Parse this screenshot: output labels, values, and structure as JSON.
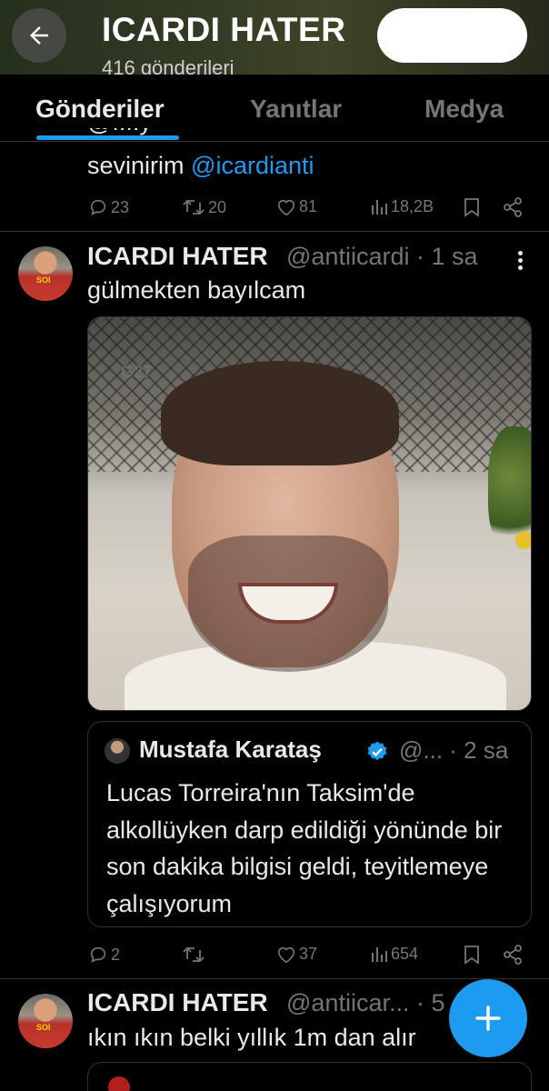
{
  "header": {
    "title": "ICARDI HATER",
    "subtitle": "416 gönderileri",
    "back_icon": "arrow-left-icon"
  },
  "tabs": [
    {
      "label": "Gönderiler",
      "active": true
    },
    {
      "label": "Yanıtlar",
      "active": false
    },
    {
      "label": "Medya",
      "active": false
    }
  ],
  "tweets": [
    {
      "text_partial_top": "@ı.ı.y",
      "text": "sevinirim",
      "mention": "@icardianti",
      "replies": "23",
      "retweets": "20",
      "likes": "81",
      "views": "18,2B"
    },
    {
      "name": "ICARDI HATER",
      "handle": "@antiicardi · 1 sa",
      "text": "gülmekten bayılcam",
      "media_watermark": "G27",
      "quote": {
        "name": "Mustafa Karataş",
        "handle": "@... · 2 sa",
        "text": "Lucas Torreira'nın Taksim'de alkollüyken darp edildiği yönünde bir son dakika bilgisi geldi, teyitlemeye çalışıyorum"
      },
      "replies": "2",
      "retweets": "",
      "likes": "37",
      "views": "654"
    },
    {
      "name": "ICARDI HATER",
      "handle": "@antiicar... · 5",
      "text": "ıkın ıkın belki yıllık 1m dan alır"
    }
  ],
  "colors": {
    "accent": "#1d9bf0",
    "muted": "#71767b",
    "text": "#e7e9ea",
    "background": "#000000",
    "divider": "#2f3336"
  }
}
